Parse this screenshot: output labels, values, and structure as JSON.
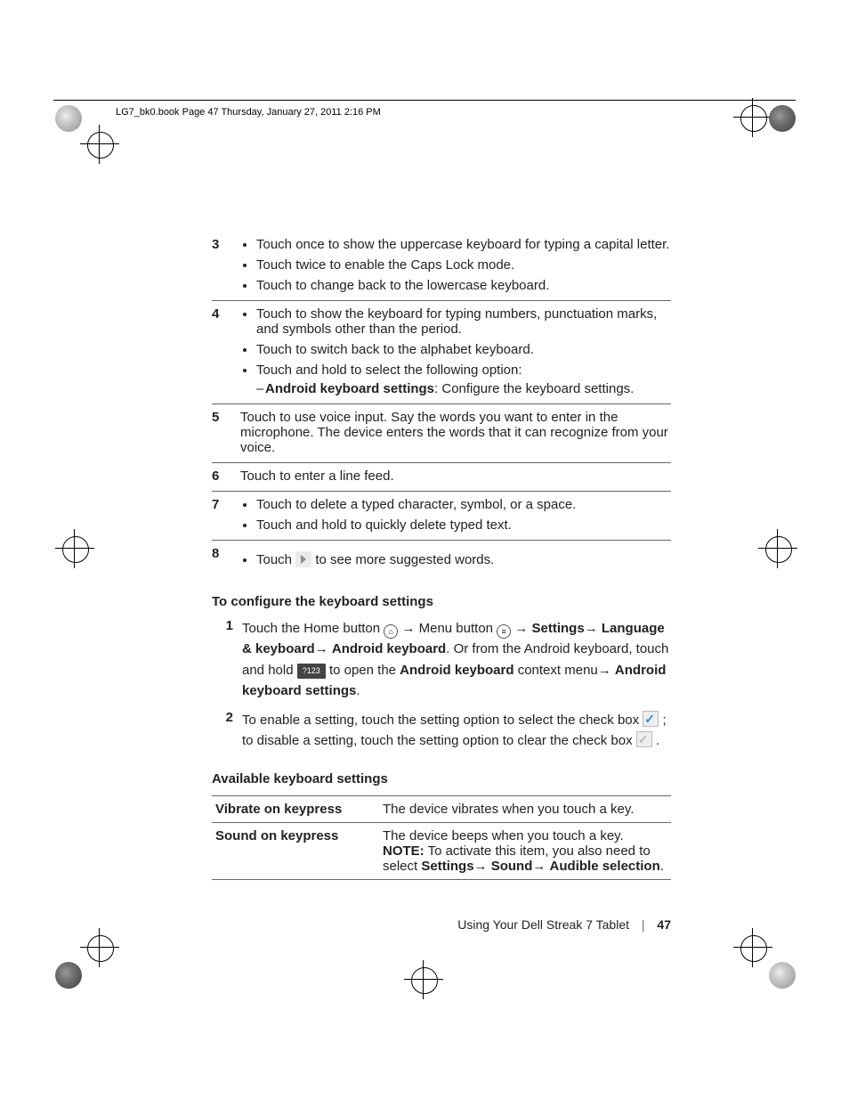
{
  "header_line": "LG7_bk0.book  Page 47  Thursday, January 27, 2011  2:16 PM",
  "rows": {
    "r3": {
      "num": "3",
      "b1": "Touch once to show the uppercase keyboard for typing a capital letter.",
      "b2": "Touch twice to enable the Caps Lock mode.",
      "b3": "Touch to change back to the lowercase keyboard."
    },
    "r4": {
      "num": "4",
      "b1": "Touch to show the keyboard for typing numbers, punctuation marks, and symbols other than the period.",
      "b2": "Touch to switch back to the alphabet keyboard.",
      "b3": "Touch and hold to select the following option:",
      "sub_label": "Android keyboard settings",
      "sub_text": ": Configure the keyboard settings."
    },
    "r5": {
      "num": "5",
      "text": "Touch to use voice input. Say the words you want to enter in the microphone. The device enters the words that it can recognize from your voice."
    },
    "r6": {
      "num": "6",
      "text": "Touch to enter a line feed."
    },
    "r7": {
      "num": "7",
      "b1": "Touch to delete a typed character, symbol, or a space.",
      "b2": "Touch and hold to quickly delete typed text."
    },
    "r8": {
      "num": "8",
      "pre": "Touch ",
      "post": " to see more suggested words."
    }
  },
  "heading_configure": "To configure the keyboard settings",
  "steps": {
    "s1": {
      "num": "1",
      "t1": "Touch the Home button ",
      "t2": " → Menu button ",
      "t3": " → ",
      "settings": "Settings",
      "arrow1": "→ ",
      "lang": "Language & keyboard",
      "arrow2": "→ ",
      "akb": "Android keyboard",
      "t4": ". Or from the Android keyboard, touch and hold ",
      "key_label": "?123",
      "t5": " to open the ",
      "akb2": "Android keyboard",
      "t6": " context menu→ ",
      "akbs": "Android keyboard settings",
      "t7": "."
    },
    "s2": {
      "num": "2",
      "t1": "To enable a setting, touch the setting option to select the check box ",
      "t2": " ; to disable a setting, touch the setting option to clear the check box ",
      "t3": " ."
    }
  },
  "heading_available": "Available keyboard settings",
  "table": {
    "r1": {
      "label": "Vibrate on keypress",
      "desc": "The device vibrates when you touch a key."
    },
    "r2": {
      "label": "Sound on keypress",
      "desc": "The device beeps when you touch a key.",
      "note_tag": "NOTE:",
      "note1": " To activate this item, you also need to select ",
      "p1": "Settings",
      "a1": "→ ",
      "p2": "Sound",
      "a2": "→ ",
      "p3": "Audible selection",
      "end": "."
    }
  },
  "footer": {
    "title": "Using Your Dell Streak 7 Tablet",
    "page": "47"
  }
}
